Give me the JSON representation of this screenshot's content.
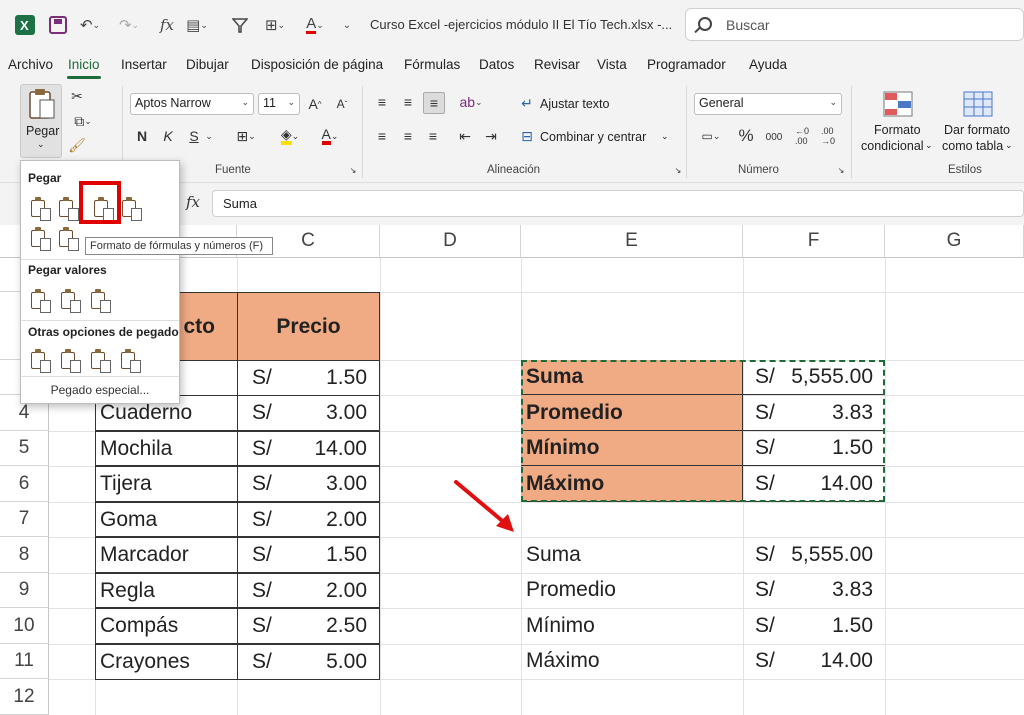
{
  "title_bar": {
    "doc_title": "Curso Excel -ejercicios módulo II El Tío Tech.xlsx  -...",
    "search_placeholder": "Buscar",
    "fx_glyph": "fx"
  },
  "tabs": [
    "Archivo",
    "Inicio",
    "Insertar",
    "Dibujar",
    "Disposición de página",
    "Fórmulas",
    "Datos",
    "Revisar",
    "Vista",
    "Programador",
    "Ayuda"
  ],
  "active_tab": "Inicio",
  "ribbon": {
    "paste_label": "Pegar",
    "font_name": "Aptos Narrow",
    "font_size": "11",
    "bold": "N",
    "italic": "K",
    "underline": "S",
    "font_group": "Fuente",
    "wrap_text": "Ajustar texto",
    "merge_center": "Combinar y centrar",
    "align_group": "Alineación",
    "number_format": "General",
    "percent": "%",
    "thousands": "000",
    "number_group": "Número",
    "cond_format_1": "Formato",
    "cond_format_2": "condicional",
    "table_format_1": "Dar formato",
    "table_format_2": "como tabla",
    "styles_group": "Estilos"
  },
  "formula_bar": {
    "fx": "fx",
    "value": "Suma"
  },
  "columns": [
    "C",
    "D",
    "E",
    "F",
    "G"
  ],
  "rows": [
    "4",
    "5",
    "6",
    "7",
    "8",
    "9",
    "10",
    "11",
    "12"
  ],
  "table1": {
    "header_product_partial": "cto",
    "header_price": "Precio",
    "items": [
      {
        "name": "",
        "cur": "S/",
        "price": "1.50"
      },
      {
        "name": "Cuaderno",
        "cur": "S/",
        "price": "3.00"
      },
      {
        "name": "Mochila",
        "cur": "S/",
        "price": "14.00"
      },
      {
        "name": "Tijera",
        "cur": "S/",
        "price": "3.00"
      },
      {
        "name": "Goma",
        "cur": "S/",
        "price": "2.00"
      },
      {
        "name": "Marcador",
        "cur": "S/",
        "price": "1.50"
      },
      {
        "name": "Regla",
        "cur": "S/",
        "price": "2.00"
      },
      {
        "name": "Compás",
        "cur": "S/",
        "price": "2.50"
      },
      {
        "name": "Crayones",
        "cur": "S/",
        "price": "5.00"
      }
    ]
  },
  "summary_copied": [
    {
      "label": "Suma",
      "cur": "S/",
      "value": "5,555.00"
    },
    {
      "label": "Promedio",
      "cur": "S/",
      "value": "3.83"
    },
    {
      "label": "Mínimo",
      "cur": "S/",
      "value": "1.50"
    },
    {
      "label": "Máximo",
      "cur": "S/",
      "value": "14.00"
    }
  ],
  "summary_pasted": [
    {
      "label": "Suma",
      "cur": "S/",
      "value": "5,555.00"
    },
    {
      "label": "Promedio",
      "cur": "S/",
      "value": "3.83"
    },
    {
      "label": "Mínimo",
      "cur": "S/",
      "value": "1.50"
    },
    {
      "label": "Máximo",
      "cur": "S/",
      "value": "14.00"
    }
  ],
  "paste_menu": {
    "section_paste": "Pegar",
    "section_values": "Pegar valores",
    "section_other": "Otras opciones de pegado",
    "special": "Pegado especial...",
    "tooltip": "Formato de fórmulas y números (F)"
  },
  "colors": {
    "accent": "#1e6b3a",
    "header_fill": "#f0aa84",
    "highlight": "#e00000",
    "arrow": "#e01010"
  }
}
